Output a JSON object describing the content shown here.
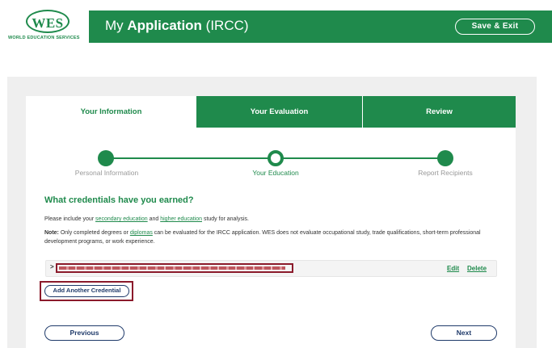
{
  "brand": {
    "logo_text": "WES",
    "logo_subtitle": "WORLD EDUCATION SERVICES",
    "color_primary": "#1f8a4c",
    "color_navy": "#1f3a6a",
    "color_highlight": "#8b1a2b"
  },
  "header": {
    "title_prefix": "My ",
    "title_bold": "Application",
    "title_suffix": " (IRCC)",
    "save_exit_label": "Save & Exit"
  },
  "tabs": [
    {
      "label": "Your Information",
      "active": true
    },
    {
      "label": "Your Evaluation",
      "active": false
    },
    {
      "label": "Review",
      "active": false
    }
  ],
  "stepper": [
    {
      "label": "Personal Information",
      "state": "done"
    },
    {
      "label": "Your Education",
      "state": "current"
    },
    {
      "label": "Report Recipients",
      "state": "upcoming"
    }
  ],
  "content": {
    "question": "What credentials have you earned?",
    "p1_a": "Please include your ",
    "p1_link1": "secondary education",
    "p1_b": " and ",
    "p1_link2": "higher education",
    "p1_c": " study for analysis.",
    "p2_note": "Note:",
    "p2_a": " Only completed degrees or ",
    "p2_link": "diplomas",
    "p2_b": " can be evaluated for the IRCC application. WES does not evaluate occupational study, trade qualifications, short-term professional development programs, or work experience."
  },
  "credential": {
    "arrow": ">",
    "edit_label": "Edit",
    "delete_label": "Delete"
  },
  "actions": {
    "add_credential_label": "Add Another Credential",
    "previous_label": "Previous",
    "next_label": "Next"
  }
}
